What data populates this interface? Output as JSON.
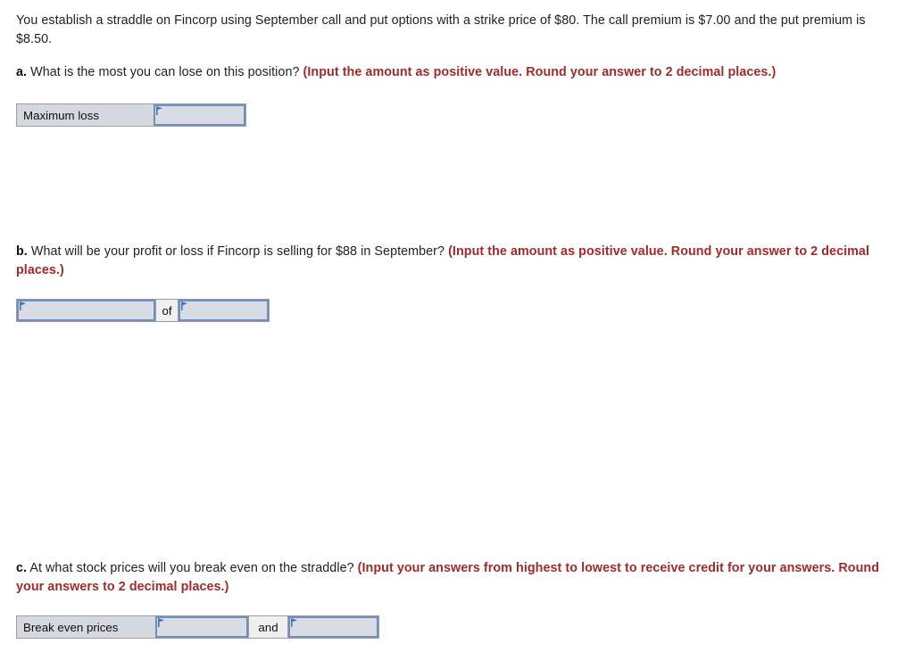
{
  "document": {
    "intro": "You establish a straddle on Fincorp using September call and put options with a strike price of $80. The call premium is $7.00 and the put premium is $8.50."
  },
  "questions": [
    {
      "id": "a",
      "label": "a.",
      "text": "What is the most you can lose on this position?",
      "note": "(Input the amount as positive value. Round your answer to 2 decimal places.)",
      "row": {
        "label": "Maximum loss",
        "inputs": [
          {
            "name": "maximum-loss-input",
            "value": "",
            "placeholder": ""
          }
        ]
      }
    },
    {
      "id": "b",
      "label": "b.",
      "text": "What will be your profit or loss if Fincorp is selling for $88 in September?",
      "note": "(Input the amount as positive value. Round your answer to 2 decimal places.)",
      "row": {
        "separator": "of",
        "inputs": [
          {
            "name": "profit-loss-type-input",
            "value": "",
            "placeholder": ""
          },
          {
            "name": "profit-loss-amount-input",
            "value": "",
            "placeholder": ""
          }
        ]
      }
    },
    {
      "id": "c",
      "label": "c.",
      "text": "At what stock prices will you break even on the straddle?",
      "note": "(Input your answers from highest to lowest to receive credit for your answers. Round your answers to 2 decimal places.)",
      "row": {
        "label": "Break even prices",
        "separator": "and",
        "inputs": [
          {
            "name": "break-even-high-input",
            "value": "",
            "placeholder": ""
          },
          {
            "name": "break-even-low-input",
            "value": "",
            "placeholder": ""
          }
        ]
      }
    }
  ],
  "colors": {
    "note_red": "#a32a2a",
    "input_fill": "#d8dce4",
    "input_border": "#6f8fbe",
    "cell_gray": "#d4d8df",
    "separator_gray": "#f0f0f0",
    "flag_blue": "#4a74b5"
  },
  "icons": {
    "flag": "answer-flag-icon"
  }
}
